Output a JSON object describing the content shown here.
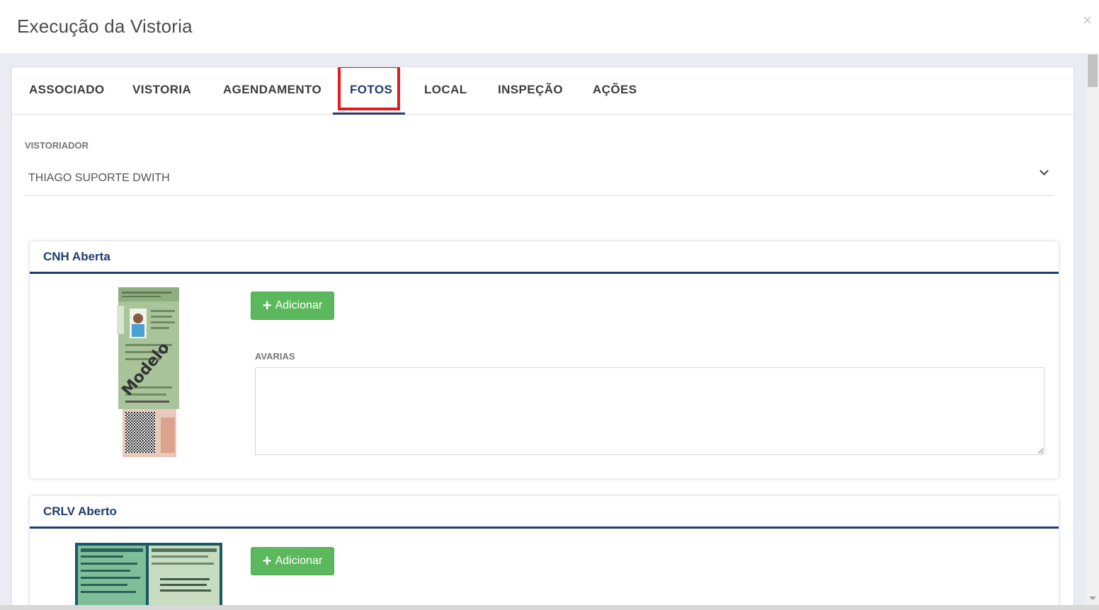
{
  "modal": {
    "title": "Execução da Vistoria",
    "close_label": "×"
  },
  "tabs": [
    {
      "label": "ASSOCIADO"
    },
    {
      "label": "VISTORIA"
    },
    {
      "label": "AGENDAMENTO"
    },
    {
      "label": "FOTOS"
    },
    {
      "label": "LOCAL"
    },
    {
      "label": "INSPEÇÃO"
    },
    {
      "label": "AÇÕES"
    }
  ],
  "active_tab": "FOTOS",
  "vistoriador": {
    "label": "VISTORIADOR",
    "value": "THIAGO SUPORTE DWITH"
  },
  "sections": [
    {
      "title": "CNH Aberta",
      "add_label": "Adicionar",
      "avarias_label": "AVARIAS",
      "avarias_value": "",
      "thumb_watermark": "Modelo"
    },
    {
      "title": "CRLV Aberto",
      "add_label": "Adicionar"
    }
  ],
  "colors": {
    "accent": "#1f3c6e",
    "success_button": "#5cb85c",
    "highlight_box": "#e21c1c",
    "overlay_background": "#ebebf3"
  }
}
